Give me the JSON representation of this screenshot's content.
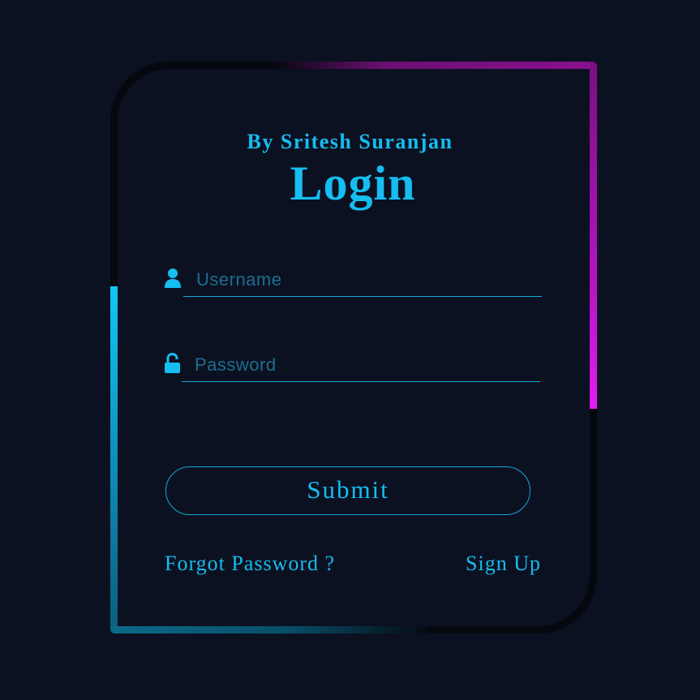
{
  "header": {
    "subtitle": "By Sritesh Suranjan",
    "title": "Login"
  },
  "form": {
    "username": {
      "placeholder": "Username",
      "value": "",
      "icon": "user-icon"
    },
    "password": {
      "placeholder": "Password",
      "value": "",
      "icon": "unlock-icon"
    },
    "submit_label": "Submit"
  },
  "links": {
    "forgot": "Forgot Password ?",
    "signup": "Sign Up"
  },
  "colors": {
    "background": "#0c1121",
    "accent": "#16bdf0",
    "glow_magenta": "#e01ef0",
    "glow_cyan": "#12c7f5"
  }
}
